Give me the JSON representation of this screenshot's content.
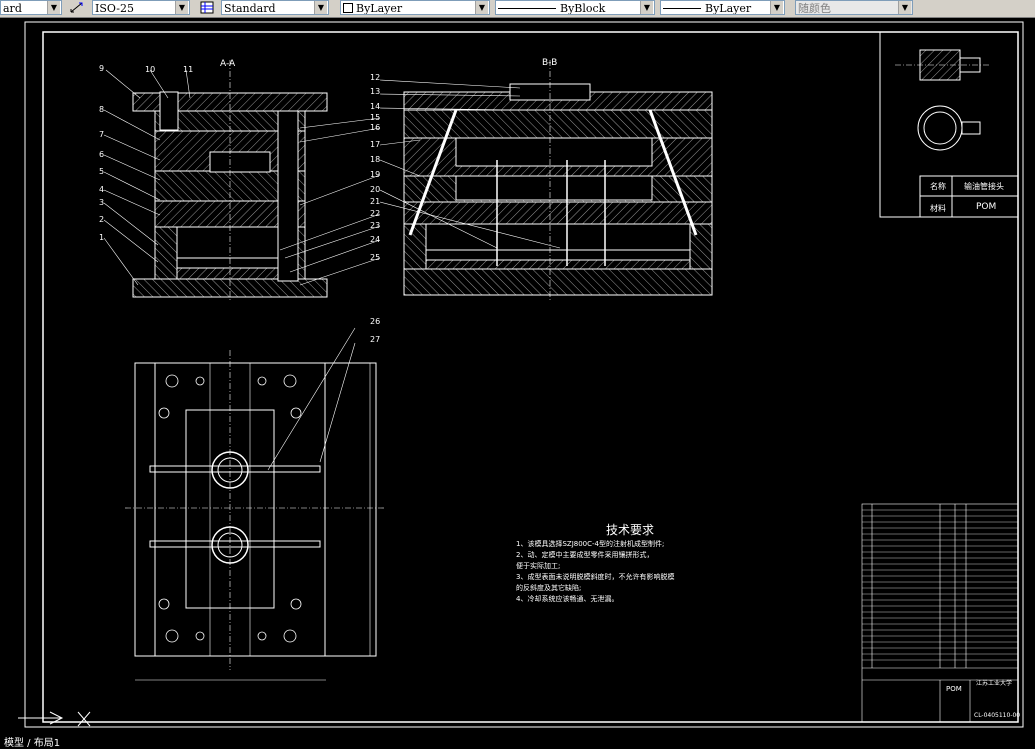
{
  "toolbar": {
    "text_style_partial": "ard",
    "dim_style": "ISO-25",
    "table_style": "Standard",
    "layer_value": "ByLayer",
    "linetype_value": "ByBlock",
    "lineweight_value": "ByLayer",
    "color_value": "随颜色"
  },
  "drawing": {
    "section_aa": "A-A",
    "section_bb": "B-B",
    "part_labels_left": [
      "9",
      "10",
      "11",
      "8",
      "7",
      "6",
      "5",
      "4",
      "3",
      "2",
      "1"
    ],
    "part_labels_mid": [
      "12",
      "13",
      "14",
      "15",
      "16",
      "17",
      "18",
      "19",
      "20",
      "21",
      "22",
      "23",
      "24",
      "25"
    ],
    "part_labels_plan": [
      "26",
      "27"
    ],
    "part_info": {
      "name_label": "名称",
      "name_value": "输油管接头",
      "material_label": "材料",
      "material_value": "POM"
    },
    "tech_requirements": {
      "title": "技术要求",
      "lines": [
        "1、该模具选择SZJ800C-4型的注射机成型制件;",
        "2、动、定模中主要成型零件采用镶拼形式，",
        "便于实际加工;",
        "3、成型表面未说明脱模斜度时，不允许有影响脱模",
        "的反斜度及其它缺陷;",
        "4、冷却系统应该畅通、无泄漏。"
      ]
    },
    "title_block": {
      "material": "POM",
      "school": "江苏工业大学",
      "drawing_no": "CL-0405110-00"
    }
  },
  "statusbar": {
    "command_partial": "模型 / 布局1"
  },
  "colors": {
    "background": "#000000",
    "lines": "#ffffff",
    "toolbar": "#d4d0c8"
  }
}
